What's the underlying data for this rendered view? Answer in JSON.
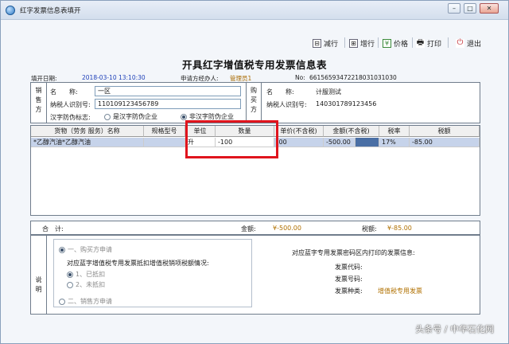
{
  "window": {
    "title": "红字发票信息表填开",
    "min_label": "–",
    "max_label": "□",
    "close_label": "✕"
  },
  "toolbar": {
    "reduce_row": "减行",
    "add_row": "增行",
    "price": "价格",
    "print": "打印",
    "exit": "退出"
  },
  "heading": "开具红字增值税专用发票信息表",
  "meta": {
    "fill_date_label": "填开日期:",
    "fill_date": "2018-03-10 13:10:30",
    "applicant_label": "申请方经办人:",
    "applicant": "管理员1",
    "no_label": "No:",
    "no": "66156593472218031031030"
  },
  "seller": {
    "side_label": [
      "销",
      "售",
      "方"
    ],
    "name_label": "名　　称:",
    "name": "一区",
    "taxid_label": "纳税人识别号:",
    "taxid": "110109123456789",
    "anti_label": "汉字防伪标志:",
    "opt1": "是汉字防伪企业",
    "opt2": "非汉字防伪企业"
  },
  "buyer": {
    "side_label": [
      "购",
      "买",
      "方"
    ],
    "name_label": "名　　称:",
    "name": "计服测试",
    "taxid_label": "纳税人识别号:",
    "taxid": "140301789123456"
  },
  "table": {
    "headers": [
      "货物（劳务 服务）名称",
      "规格型号",
      "单位",
      "数量",
      "单价(不含税)",
      "金额(不含税)",
      "税率",
      "税额"
    ],
    "row": [
      "*乙醇汽油*乙醇汽油",
      "",
      "升",
      "-100",
      ".00",
      "-500.00",
      "17%",
      "-85.00"
    ]
  },
  "totals": {
    "label": "合　计:",
    "amount_label": "金额:",
    "amount": "¥-500.00",
    "tax_label": "税额:",
    "tax": "¥-85.00"
  },
  "notes": {
    "side_label": [
      "说",
      "明"
    ],
    "opt_buyer": "一、购买方申请",
    "deduct_q": "对应蓝字增值税专用发票抵扣增值税销项税额情况:",
    "deducted": "1、已抵扣",
    "not_deducted": "2、未抵扣",
    "opt_seller": "二、销售方申请",
    "seller_info": "对应蓝字专用发票密码区内打印的发票信息:",
    "code_label": "发票代码:",
    "num_label": "发票号码:",
    "type_label": "发票种类:",
    "type": "增值税专用发票"
  },
  "watermark": "头条号 / 中华石化网",
  "colors": {
    "highlight_border": "#e0141d",
    "accent_blue": "#1d3fb8"
  }
}
